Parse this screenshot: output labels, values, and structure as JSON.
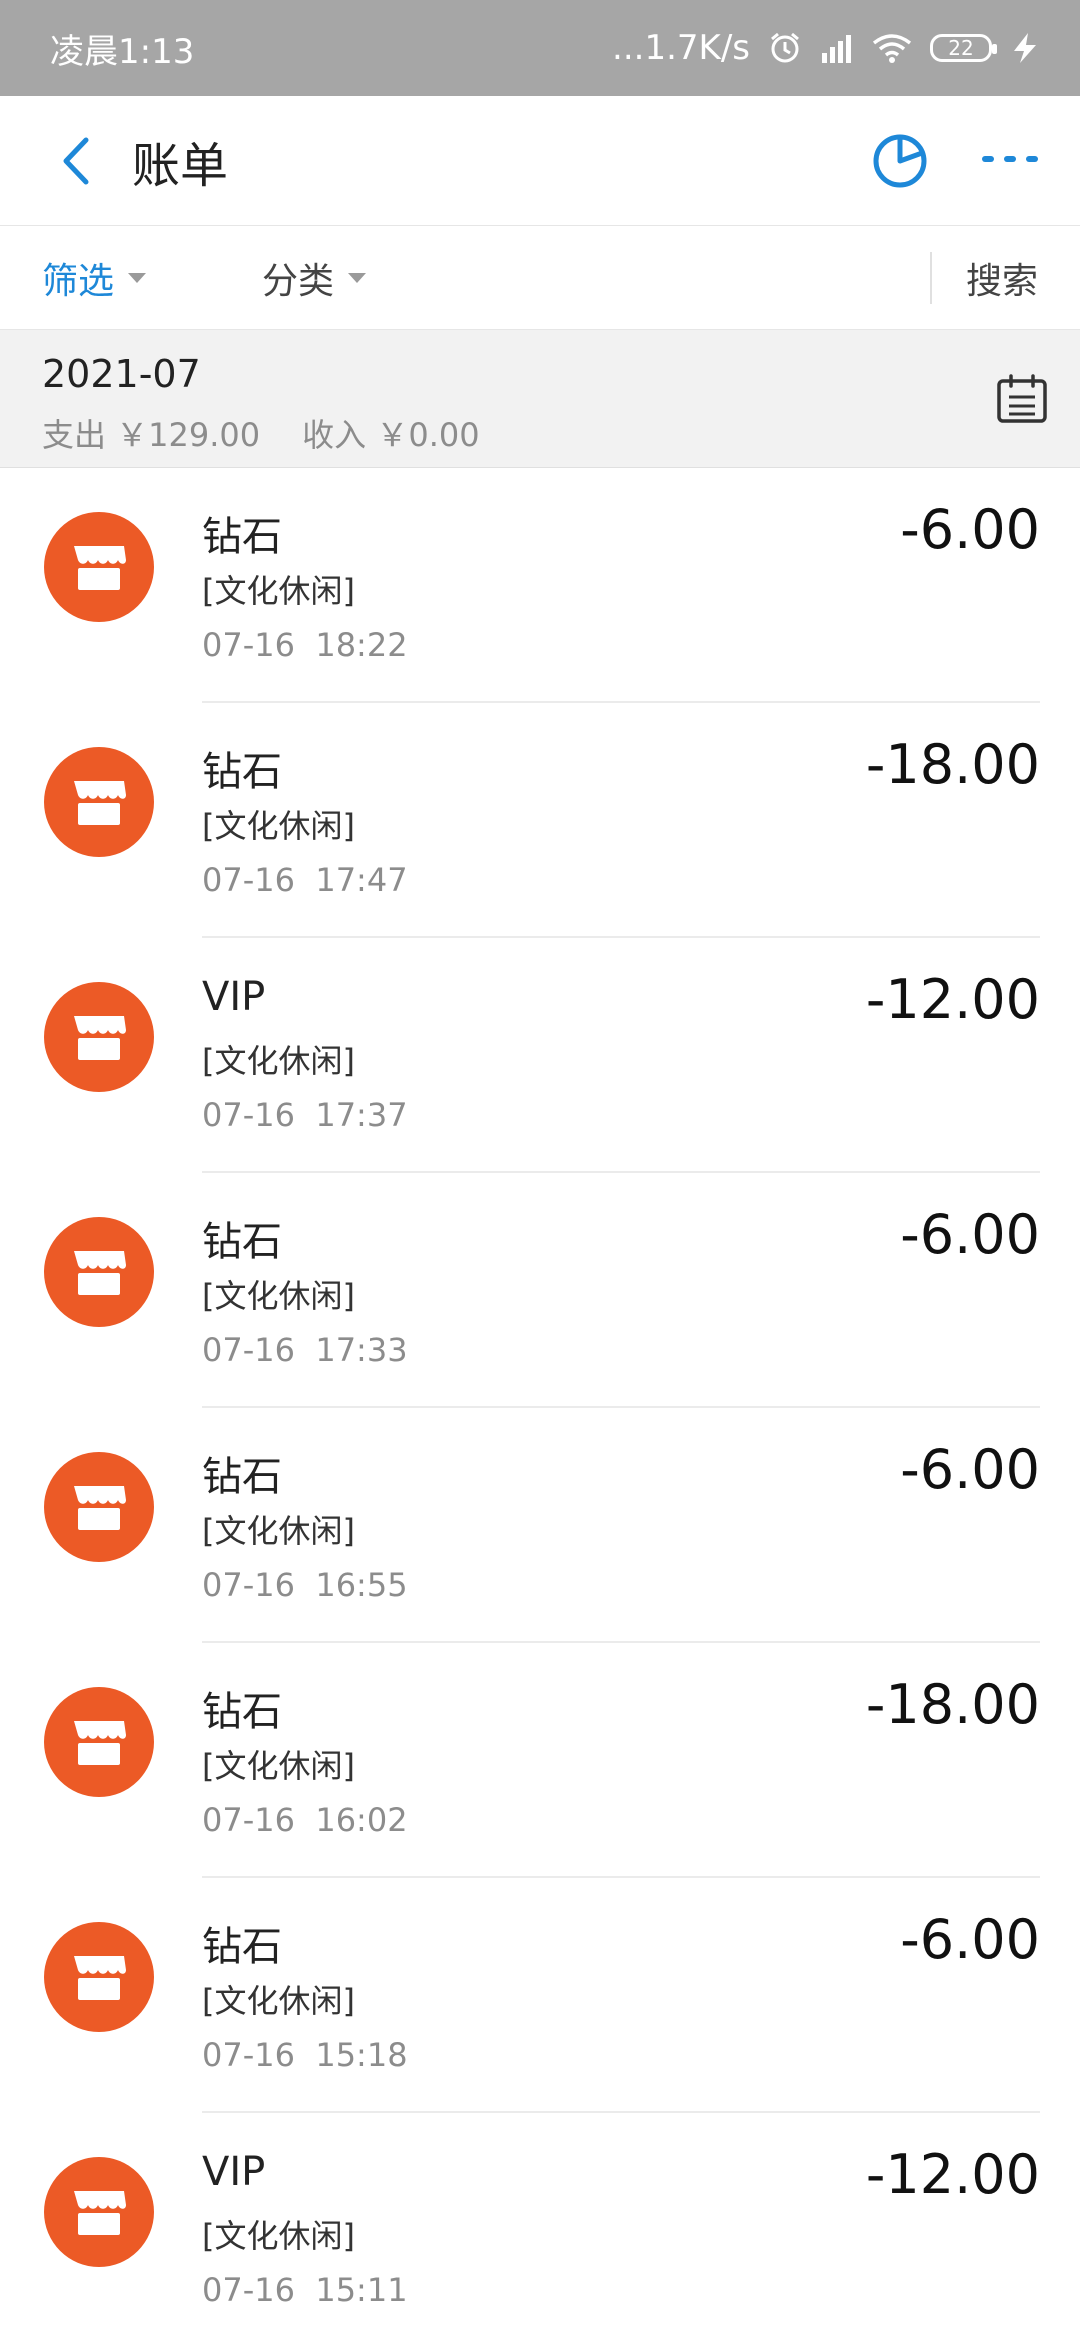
{
  "status_bar": {
    "time": "凌晨1:13",
    "network_speed": "...1.7K/s",
    "battery": "22"
  },
  "header": {
    "title": "账单"
  },
  "filters": {
    "filter_label": "筛选",
    "category_label": "分类",
    "search_label": "搜索"
  },
  "month": {
    "label": "2021-07",
    "expense": "支出 ￥129.00",
    "income": "收入 ￥0.00"
  },
  "colors": {
    "accent": "#1e88d8",
    "avatar": "#ec5a26"
  },
  "transactions": [
    {
      "name": "钻石",
      "category": "[文化休闲]",
      "date": "07-16",
      "time": "18:22",
      "amount": "-6.00"
    },
    {
      "name": "钻石",
      "category": "[文化休闲]",
      "date": "07-16",
      "time": "17:47",
      "amount": "-18.00"
    },
    {
      "name": "VIP",
      "category": "[文化休闲]",
      "date": "07-16",
      "time": "17:37",
      "amount": "-12.00"
    },
    {
      "name": "钻石",
      "category": "[文化休闲]",
      "date": "07-16",
      "time": "17:33",
      "amount": "-6.00"
    },
    {
      "name": "钻石",
      "category": "[文化休闲]",
      "date": "07-16",
      "time": "16:55",
      "amount": "-6.00"
    },
    {
      "name": "钻石",
      "category": "[文化休闲]",
      "date": "07-16",
      "time": "16:02",
      "amount": "-18.00"
    },
    {
      "name": "钻石",
      "category": "[文化休闲]",
      "date": "07-16",
      "time": "15:18",
      "amount": "-6.00"
    },
    {
      "name": "VIP",
      "category": "[文化休闲]",
      "date": "07-16",
      "time": "15:11",
      "amount": "-12.00"
    }
  ]
}
